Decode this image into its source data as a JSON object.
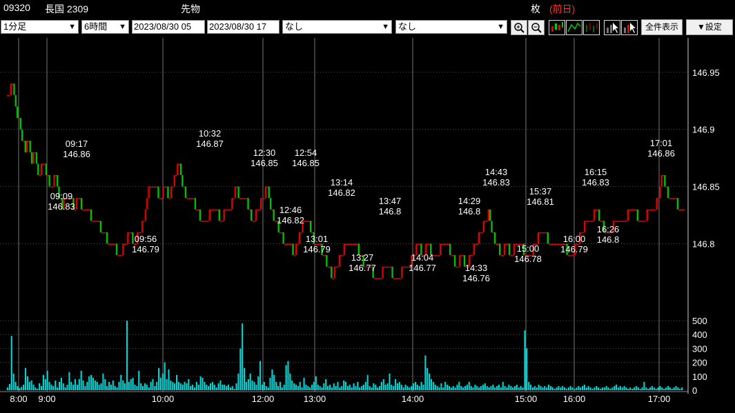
{
  "header": {
    "code": "09320",
    "name": "長国 2309",
    "category": "先物",
    "unit": "枚",
    "prev_day": "(前日)"
  },
  "toolbar": {
    "interval": "1分足",
    "span": "6時間",
    "start": "2023/08/30 05",
    "end": "2023/08/30 17",
    "indicator1": "なし",
    "indicator2": "なし",
    "show_all_label": "全件表示",
    "settings_label": "▼設定"
  },
  "colors": {
    "up": "#e00000",
    "down": "#00c000",
    "volume": "#00d8d8",
    "grid": "#555555"
  },
  "chart_data": {
    "type": "candlestick",
    "price_axis": {
      "ticks": [
        146.8,
        146.85,
        146.9,
        146.95
      ],
      "range": [
        146.74,
        146.98
      ]
    },
    "volume_axis": {
      "ticks": [
        0,
        100,
        200,
        300,
        400,
        500
      ],
      "range": [
        0,
        520
      ]
    },
    "time_ticks": [
      "8:00",
      "9:00",
      "10:00",
      "12:00",
      "13:00",
      "14:00",
      "15:00",
      "16:00",
      "17:00"
    ],
    "annotations": [
      {
        "time": "09:17",
        "price": "146.86"
      },
      {
        "time": "09:09",
        "price": "146.83"
      },
      {
        "time": "10:32",
        "price": "146.87"
      },
      {
        "time": "09:56",
        "price": "146.79"
      },
      {
        "time": "12:30",
        "price": "146.85"
      },
      {
        "time": "12:54",
        "price": "146.85"
      },
      {
        "time": "12:46",
        "price": "146.82"
      },
      {
        "time": "13:14",
        "price": "146.82"
      },
      {
        "time": "13:01",
        "price": "146.79"
      },
      {
        "time": "13:47",
        "price": "146.8"
      },
      {
        "time": "13:27",
        "price": "146.77"
      },
      {
        "time": "14:04",
        "price": "146.77"
      },
      {
        "time": "14:43",
        "price": "146.83"
      },
      {
        "time": "14:29",
        "price": "146.8"
      },
      {
        "time": "14:33",
        "price": "146.76"
      },
      {
        "time": "15:37",
        "price": "146.81"
      },
      {
        "time": "15:00",
        "price": "146.78"
      },
      {
        "time": "16:15",
        "price": "146.83"
      },
      {
        "time": "16:00",
        "price": "146.79"
      },
      {
        "time": "16:26",
        "price": "146.8"
      },
      {
        "time": "17:01",
        "price": "146.86"
      }
    ],
    "path": [
      [
        0,
        146.93
      ],
      [
        6,
        146.94
      ],
      [
        10,
        146.92
      ],
      [
        16,
        146.9
      ],
      [
        22,
        146.88
      ],
      [
        26,
        146.89
      ],
      [
        30,
        146.87
      ],
      [
        34,
        146.88
      ],
      [
        38,
        146.86
      ],
      [
        44,
        146.87
      ],
      [
        48,
        146.86
      ],
      [
        52,
        146.85
      ],
      [
        56,
        146.85
      ],
      [
        60,
        146.86
      ],
      [
        64,
        146.84
      ],
      [
        68,
        146.83
      ],
      [
        72,
        146.84
      ],
      [
        78,
        146.84
      ],
      [
        82,
        146.83
      ],
      [
        88,
        146.84
      ],
      [
        94,
        146.83
      ],
      [
        100,
        146.83
      ],
      [
        106,
        146.82
      ],
      [
        112,
        146.82
      ],
      [
        116,
        146.81
      ],
      [
        120,
        146.81
      ],
      [
        126,
        146.8
      ],
      [
        132,
        146.8
      ],
      [
        136,
        146.79
      ],
      [
        140,
        146.79
      ],
      [
        146,
        146.8
      ],
      [
        152,
        146.81
      ],
      [
        158,
        146.8
      ],
      [
        164,
        146.81
      ],
      [
        170,
        146.82
      ],
      [
        174,
        146.84
      ],
      [
        178,
        146.85
      ],
      [
        184,
        146.85
      ],
      [
        190,
        146.84
      ],
      [
        196,
        146.85
      ],
      [
        200,
        146.84
      ],
      [
        206,
        146.85
      ],
      [
        210,
        146.86
      ],
      [
        214,
        146.87
      ],
      [
        218,
        146.85
      ],
      [
        224,
        146.84
      ],
      [
        230,
        146.84
      ],
      [
        236,
        146.83
      ],
      [
        242,
        146.82
      ],
      [
        248,
        146.82
      ],
      [
        254,
        146.83
      ],
      [
        260,
        146.83
      ],
      [
        266,
        146.82
      ],
      [
        272,
        146.83
      ],
      [
        278,
        146.83
      ],
      [
        284,
        146.85
      ],
      [
        290,
        146.84
      ],
      [
        296,
        146.84
      ],
      [
        302,
        146.83
      ],
      [
        306,
        146.82
      ],
      [
        312,
        146.83
      ],
      [
        318,
        146.84
      ],
      [
        324,
        146.85
      ],
      [
        328,
        146.83
      ],
      [
        334,
        146.82
      ],
      [
        340,
        146.81
      ],
      [
        346,
        146.8
      ],
      [
        352,
        146.8
      ],
      [
        358,
        146.79
      ],
      [
        364,
        146.81
      ],
      [
        370,
        146.82
      ],
      [
        376,
        146.82
      ],
      [
        382,
        146.8
      ],
      [
        388,
        146.8
      ],
      [
        394,
        146.79
      ],
      [
        400,
        146.78
      ],
      [
        404,
        146.77
      ],
      [
        410,
        146.78
      ],
      [
        416,
        146.79
      ],
      [
        422,
        146.8
      ],
      [
        428,
        146.8
      ],
      [
        434,
        146.8
      ],
      [
        440,
        146.79
      ],
      [
        446,
        146.78
      ],
      [
        452,
        146.78
      ],
      [
        458,
        146.77
      ],
      [
        464,
        146.77
      ],
      [
        470,
        146.78
      ],
      [
        476,
        146.78
      ],
      [
        482,
        146.77
      ],
      [
        488,
        146.77
      ],
      [
        494,
        146.78
      ],
      [
        500,
        146.78
      ],
      [
        506,
        146.79
      ],
      [
        512,
        146.8
      ],
      [
        518,
        146.79
      ],
      [
        524,
        146.8
      ],
      [
        530,
        146.79
      ],
      [
        536,
        146.79
      ],
      [
        542,
        146.8
      ],
      [
        548,
        146.8
      ],
      [
        554,
        146.79
      ],
      [
        560,
        146.78
      ],
      [
        566,
        146.79
      ],
      [
        572,
        146.78
      ],
      [
        578,
        146.79
      ],
      [
        584,
        146.8
      ],
      [
        590,
        146.81
      ],
      [
        596,
        146.82
      ],
      [
        600,
        146.83
      ],
      [
        604,
        146.81
      ],
      [
        610,
        146.8
      ],
      [
        616,
        146.79
      ],
      [
        622,
        146.8
      ],
      [
        628,
        146.79
      ],
      [
        634,
        146.8
      ],
      [
        640,
        146.8
      ],
      [
        646,
        146.79
      ],
      [
        652,
        146.79
      ],
      [
        658,
        146.8
      ],
      [
        664,
        146.81
      ],
      [
        670,
        146.81
      ],
      [
        676,
        146.8
      ],
      [
        682,
        146.8
      ],
      [
        688,
        146.8
      ],
      [
        694,
        146.8
      ],
      [
        700,
        146.79
      ],
      [
        706,
        146.79
      ],
      [
        710,
        146.8
      ],
      [
        716,
        146.81
      ],
      [
        722,
        146.82
      ],
      [
        728,
        146.82
      ],
      [
        734,
        146.83
      ],
      [
        740,
        146.82
      ],
      [
        746,
        146.81
      ],
      [
        752,
        146.81
      ],
      [
        758,
        146.82
      ],
      [
        764,
        146.82
      ],
      [
        770,
        146.82
      ],
      [
        776,
        146.83
      ],
      [
        782,
        146.83
      ],
      [
        788,
        146.82
      ],
      [
        794,
        146.82
      ],
      [
        800,
        146.83
      ],
      [
        806,
        146.83
      ],
      [
        812,
        146.84
      ],
      [
        816,
        146.86
      ],
      [
        820,
        146.85
      ],
      [
        826,
        146.84
      ],
      [
        832,
        146.84
      ],
      [
        838,
        146.83
      ],
      [
        844,
        146.83
      ]
    ],
    "volume": [
      20,
      45,
      390,
      120,
      60,
      30,
      15,
      25,
      40,
      160,
      100,
      60,
      70,
      40,
      20,
      10,
      50,
      30,
      110,
      80,
      140,
      60,
      40,
      30,
      70,
      20,
      60,
      90,
      50,
      20,
      40,
      130,
      60,
      40,
      80,
      40,
      80,
      140,
      70,
      30,
      60,
      100,
      110,
      90,
      70,
      60,
      40,
      50,
      120,
      80,
      30,
      60,
      40,
      70,
      30,
      20,
      60,
      110,
      70,
      50,
      500,
      60,
      80,
      90,
      40,
      30,
      140,
      50,
      30,
      50,
      40,
      20,
      60,
      80,
      30,
      60,
      160,
      90,
      120,
      200,
      80,
      150,
      70,
      60,
      50,
      110,
      60,
      50,
      40,
      60,
      50,
      80,
      30,
      40,
      20,
      60,
      40,
      100,
      90,
      60,
      40,
      30,
      50,
      60,
      40,
      20,
      50,
      70,
      40,
      40,
      30,
      40,
      20,
      30,
      10,
      50,
      120,
      300,
      480,
      160,
      60,
      80,
      120,
      70,
      60,
      40,
      100,
      210,
      40,
      60,
      30,
      20,
      90,
      150,
      110,
      60,
      30,
      60,
      20,
      40,
      180,
      210,
      120,
      70,
      50,
      40,
      30,
      60,
      20,
      90,
      40,
      30,
      20,
      40,
      60,
      100,
      40,
      30,
      20,
      50,
      80,
      30,
      40,
      20,
      50,
      30,
      60,
      20,
      30,
      70,
      60,
      30,
      40,
      20,
      50,
      30,
      60,
      20,
      30,
      40,
      60,
      110,
      30,
      20,
      50,
      40,
      20,
      30,
      60,
      80,
      40,
      50,
      120,
      40,
      30,
      80,
      50,
      60,
      40,
      20,
      40,
      30,
      20,
      30,
      50,
      60,
      40,
      30,
      60,
      40,
      250,
      160,
      120,
      80,
      60,
      40,
      30,
      20,
      50,
      20,
      60,
      40,
      30,
      20,
      30,
      20,
      40,
      60,
      30,
      20,
      30,
      40,
      60,
      30,
      20,
      40,
      30,
      20,
      30,
      40,
      50,
      30,
      20,
      30,
      40,
      20,
      30,
      40,
      20,
      60,
      30,
      20,
      40,
      30,
      20,
      30,
      40,
      20,
      30,
      20,
      430,
      300,
      60,
      40,
      20,
      30,
      20,
      40,
      30,
      20,
      30,
      20,
      40,
      30,
      20,
      10,
      20,
      30,
      20,
      30,
      20,
      10,
      20,
      30,
      20,
      10,
      20,
      30,
      20,
      30,
      40,
      20,
      30,
      20,
      10,
      20,
      30,
      20,
      10,
      20,
      20,
      30,
      20,
      10,
      20,
      30,
      40,
      20,
      30,
      20,
      30,
      20,
      10,
      20,
      10,
      20,
      30,
      20,
      10,
      20,
      60,
      20,
      10,
      20,
      30,
      20,
      10,
      20,
      30,
      20,
      10,
      20,
      30,
      20,
      10,
      20,
      30,
      20,
      10,
      20
    ]
  }
}
